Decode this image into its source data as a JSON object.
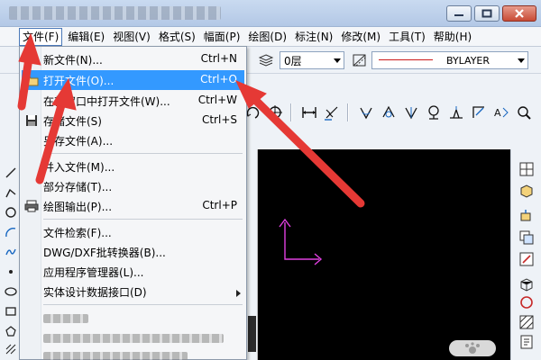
{
  "menubar": {
    "items": [
      {
        "label": "文件(F)"
      },
      {
        "label": "编辑(E)"
      },
      {
        "label": "视图(V)"
      },
      {
        "label": "格式(S)"
      },
      {
        "label": "幅面(P)"
      },
      {
        "label": "绘图(D)"
      },
      {
        "label": "标注(N)"
      },
      {
        "label": "修改(M)"
      },
      {
        "label": "工具(T)"
      },
      {
        "label": "帮助(H)"
      }
    ]
  },
  "toolbar": {
    "layer_value": "0层",
    "linetype_value": "BYLAYER"
  },
  "file_menu": {
    "items": [
      {
        "label": "新文件(N)...",
        "shortcut": "Ctrl+N"
      },
      {
        "label": "打开文件(O)...",
        "shortcut": "Ctrl+O"
      },
      {
        "label": "在新窗口中打开文件(W)...",
        "shortcut": "Ctrl+W"
      },
      {
        "label": "存储文件(S)",
        "shortcut": "Ctrl+S"
      },
      {
        "label": "另存文件(A)..."
      },
      {
        "label": "并入文件(M)..."
      },
      {
        "label": "部分存储(T)..."
      },
      {
        "label": "绘图输出(P)...",
        "shortcut": "Ctrl+P"
      },
      {
        "label": "文件检索(F)..."
      },
      {
        "label": "DWG/DXF批转换器(B)..."
      },
      {
        "label": "应用程序管理器(L)..."
      },
      {
        "label": "实体设计数据接口(D)"
      }
    ]
  },
  "colors": {
    "highlight": "#3399ff",
    "canvas": "#000000",
    "annotation_arrow": "#e53935",
    "axis_glyph": "#e040e0",
    "linetype_color": "#cc1a1a"
  }
}
